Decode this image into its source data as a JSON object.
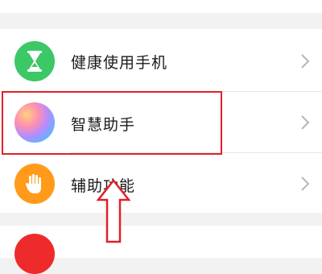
{
  "colors": {
    "page_bg": "#f2f2f2",
    "card_bg": "#ffffff",
    "annotation_red": "#e0202a",
    "top_icon": "#1cb3b0",
    "health_icon": "#3cc866",
    "accessibility_icon": "#ff9a1a",
    "bottom_icon": "#ee2b2b"
  },
  "settings": {
    "items": [
      {
        "label": "健康使用手机",
        "icon": "hourglass-icon"
      },
      {
        "label": "智慧助手",
        "icon": "gradient-orb-icon"
      },
      {
        "label": "辅助功能",
        "icon": "hand-icon"
      }
    ]
  },
  "annotation": {
    "highlight": "red-rectangle",
    "pointer": "upward-arrow-outline"
  }
}
